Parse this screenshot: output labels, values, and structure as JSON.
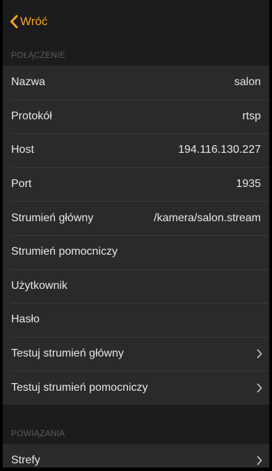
{
  "nav": {
    "back_label": "Wróć",
    "accent_color": "#f5a623"
  },
  "sections": {
    "connection": {
      "header": "POŁĄCZENIE",
      "rows": {
        "name": {
          "label": "Nazwa",
          "value": "salon"
        },
        "protocol": {
          "label": "Protokół",
          "value": "rtsp"
        },
        "host": {
          "label": "Host",
          "value": "194.116.130.227"
        },
        "port": {
          "label": "Port",
          "value": "1935"
        },
        "main_stream": {
          "label": "Strumień główny",
          "value": "/kamera/salon.stream"
        },
        "sub_stream": {
          "label": "Strumień pomocniczy",
          "value": ""
        },
        "user": {
          "label": "Użytkownik",
          "value": ""
        },
        "password": {
          "label": "Hasło",
          "value": ""
        },
        "test_main": {
          "label": "Testuj strumień główny",
          "icon": "chevron-right-icon"
        },
        "test_sub": {
          "label": "Testuj strumień pomocniczy",
          "icon": "chevron-right-icon"
        }
      }
    },
    "bindings": {
      "header": "POWIĄZANIA",
      "rows": {
        "zones": {
          "label": "Strefy",
          "icon": "chevron-right-icon"
        }
      }
    }
  }
}
